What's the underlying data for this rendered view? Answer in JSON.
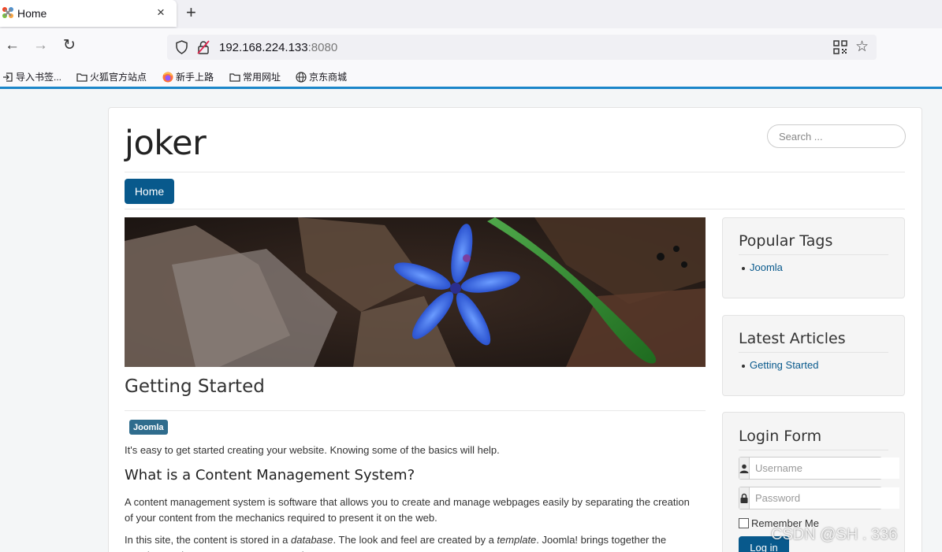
{
  "browser": {
    "tab_title": "Home",
    "tab_close": "×",
    "new_tab": "+",
    "url_host": "192.168.224.133",
    "url_port": ":8080",
    "back": "←",
    "forward": "→",
    "reload": "↻",
    "star": "☆",
    "bookmarks": [
      {
        "label": "导入书签...",
        "icon": "import-icon"
      },
      {
        "label": "火狐官方站点",
        "icon": "folder-icon"
      },
      {
        "label": "新手上路",
        "icon": "firefox-icon"
      },
      {
        "label": "常用网址",
        "icon": "folder-icon"
      },
      {
        "label": "京东商城",
        "icon": "globe-icon"
      }
    ],
    "accent_color": "#1b86c9"
  },
  "site": {
    "title": "joker",
    "search_placeholder": "Search ...",
    "nav": {
      "home_label": "Home"
    },
    "brand_color": "#08598c"
  },
  "article": {
    "title": "Getting Started",
    "tag": "Joomla",
    "intro": "It's easy to get started creating your website. Knowing some of the basics will help.",
    "h3": "What is a Content Management System?",
    "p2": "A content management system is software that allows you to create and manage webpages easily by separating the creation of your content from the mechanics required to present it on the web.",
    "p3_a": "In this site, the content is stored in a ",
    "p3_b": "database",
    "p3_c": ". The look and feel are created by a ",
    "p3_d": "template",
    "p3_e": ". Joomla! brings together the template and your content to create web pages."
  },
  "sidebar": {
    "popular_tags": {
      "title": "Popular Tags",
      "items": [
        "Joomla"
      ]
    },
    "latest_articles": {
      "title": "Latest Articles",
      "items": [
        "Getting Started"
      ]
    },
    "login": {
      "title": "Login Form",
      "username_placeholder": "Username",
      "password_placeholder": "Password",
      "remember_label": "Remember Me",
      "login_label": "Log in"
    }
  },
  "watermark": "CSDN @SH     . 336"
}
